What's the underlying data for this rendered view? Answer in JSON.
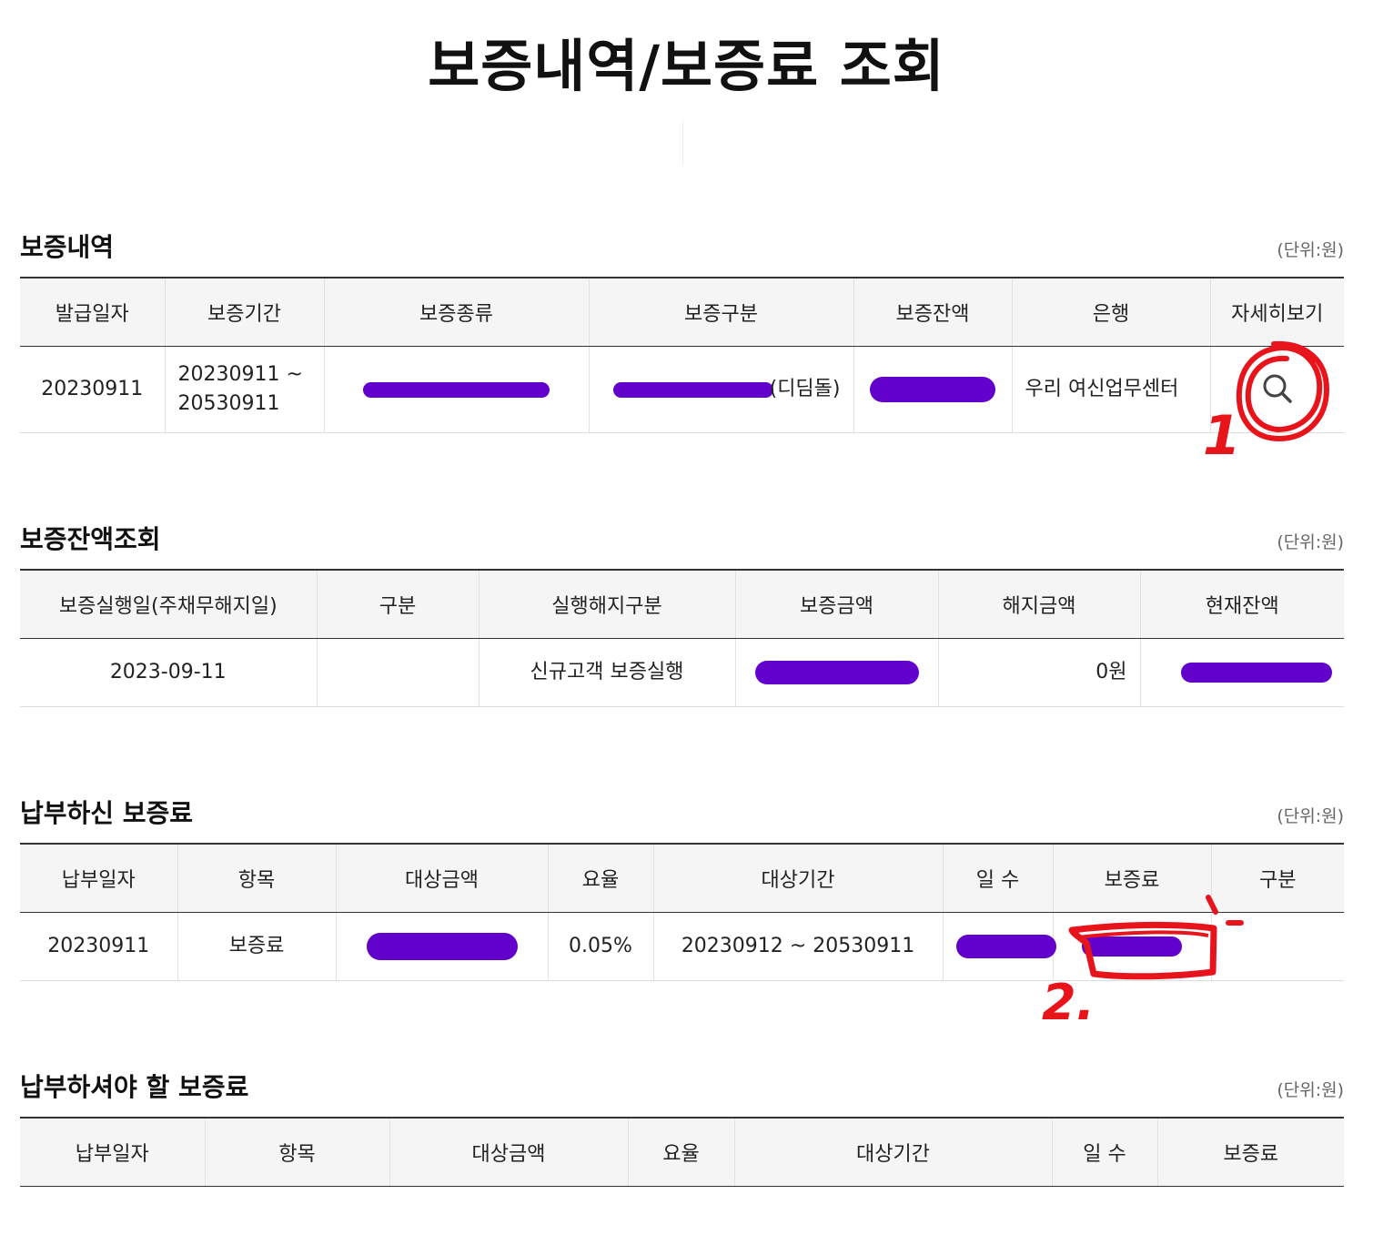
{
  "page": {
    "title": "보증내역/보증료 조회"
  },
  "guarantee_history": {
    "title": "보증내역",
    "unit": "(단위:원)",
    "headers": [
      "발급일자",
      "보증기간",
      "보증종류",
      "보증구분",
      "보증잔액",
      "은행",
      "자세히보기"
    ],
    "row": {
      "issue_date": "20230911",
      "period": "20230911 ~ 20530911",
      "type_suffix": "",
      "category_suffix": "(디딤돌)",
      "balance": "",
      "bank": "우리 여신업무센터",
      "detail_icon": "search-icon"
    }
  },
  "balance_inquiry": {
    "title": "보증잔액조회",
    "unit": "(단위:원)",
    "headers": [
      "보증실행일(주채무해지일)",
      "구분",
      "실행해지구분",
      "보증금액",
      "해지금액",
      "현재잔액"
    ],
    "row": {
      "execution_date": "2023-09-11",
      "category": "",
      "exec_cancel_type": "신규고객 보증실행",
      "guarantee_amount": "",
      "cancel_amount": "0원",
      "current_balance": ""
    }
  },
  "paid_fees": {
    "title": "납부하신 보증료",
    "unit": "(단위:원)",
    "headers": [
      "납부일자",
      "항목",
      "대상금액",
      "요율",
      "대상기간",
      "일 수",
      "보증료",
      "구분"
    ],
    "row": {
      "pay_date": "20230911",
      "item": "보증료",
      "target_amount": "",
      "rate": "0.05%",
      "target_period": "20230912 ~ 20530911",
      "days": "",
      "fee": "",
      "category": ""
    }
  },
  "due_fees": {
    "title": "납부하셔야 할 보증료",
    "unit": "(단위:원)",
    "headers": [
      "납부일자",
      "항목",
      "대상금액",
      "요율",
      "대상기간",
      "일 수",
      "보증료"
    ]
  },
  "annotations": {
    "marker_1": "1",
    "marker_2": "2.",
    "color": "#e8141c"
  },
  "colors": {
    "redaction": "#6200cc",
    "header_bg": "#f5f5f5",
    "annotation": "#e8141c"
  }
}
